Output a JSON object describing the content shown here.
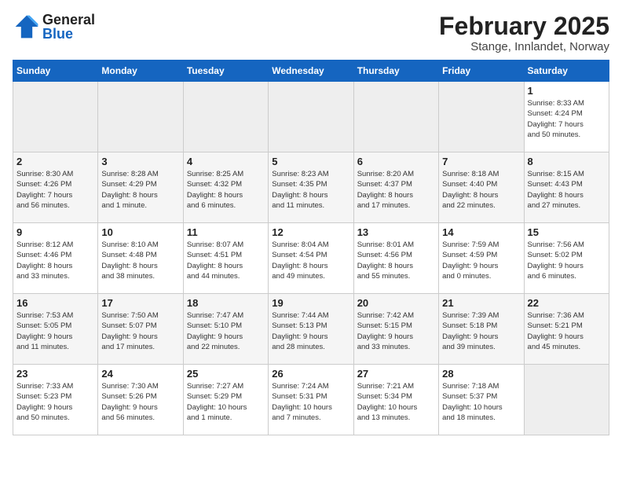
{
  "header": {
    "logo_general": "General",
    "logo_blue": "Blue",
    "title": "February 2025",
    "subtitle": "Stange, Innlandet, Norway"
  },
  "weekdays": [
    "Sunday",
    "Monday",
    "Tuesday",
    "Wednesday",
    "Thursday",
    "Friday",
    "Saturday"
  ],
  "weeks": [
    [
      {
        "num": "",
        "info": ""
      },
      {
        "num": "",
        "info": ""
      },
      {
        "num": "",
        "info": ""
      },
      {
        "num": "",
        "info": ""
      },
      {
        "num": "",
        "info": ""
      },
      {
        "num": "",
        "info": ""
      },
      {
        "num": "1",
        "info": "Sunrise: 8:33 AM\nSunset: 4:24 PM\nDaylight: 7 hours\nand 50 minutes."
      }
    ],
    [
      {
        "num": "2",
        "info": "Sunrise: 8:30 AM\nSunset: 4:26 PM\nDaylight: 7 hours\nand 56 minutes."
      },
      {
        "num": "3",
        "info": "Sunrise: 8:28 AM\nSunset: 4:29 PM\nDaylight: 8 hours\nand 1 minute."
      },
      {
        "num": "4",
        "info": "Sunrise: 8:25 AM\nSunset: 4:32 PM\nDaylight: 8 hours\nand 6 minutes."
      },
      {
        "num": "5",
        "info": "Sunrise: 8:23 AM\nSunset: 4:35 PM\nDaylight: 8 hours\nand 11 minutes."
      },
      {
        "num": "6",
        "info": "Sunrise: 8:20 AM\nSunset: 4:37 PM\nDaylight: 8 hours\nand 17 minutes."
      },
      {
        "num": "7",
        "info": "Sunrise: 8:18 AM\nSunset: 4:40 PM\nDaylight: 8 hours\nand 22 minutes."
      },
      {
        "num": "8",
        "info": "Sunrise: 8:15 AM\nSunset: 4:43 PM\nDaylight: 8 hours\nand 27 minutes."
      }
    ],
    [
      {
        "num": "9",
        "info": "Sunrise: 8:12 AM\nSunset: 4:46 PM\nDaylight: 8 hours\nand 33 minutes."
      },
      {
        "num": "10",
        "info": "Sunrise: 8:10 AM\nSunset: 4:48 PM\nDaylight: 8 hours\nand 38 minutes."
      },
      {
        "num": "11",
        "info": "Sunrise: 8:07 AM\nSunset: 4:51 PM\nDaylight: 8 hours\nand 44 minutes."
      },
      {
        "num": "12",
        "info": "Sunrise: 8:04 AM\nSunset: 4:54 PM\nDaylight: 8 hours\nand 49 minutes."
      },
      {
        "num": "13",
        "info": "Sunrise: 8:01 AM\nSunset: 4:56 PM\nDaylight: 8 hours\nand 55 minutes."
      },
      {
        "num": "14",
        "info": "Sunrise: 7:59 AM\nSunset: 4:59 PM\nDaylight: 9 hours\nand 0 minutes."
      },
      {
        "num": "15",
        "info": "Sunrise: 7:56 AM\nSunset: 5:02 PM\nDaylight: 9 hours\nand 6 minutes."
      }
    ],
    [
      {
        "num": "16",
        "info": "Sunrise: 7:53 AM\nSunset: 5:05 PM\nDaylight: 9 hours\nand 11 minutes."
      },
      {
        "num": "17",
        "info": "Sunrise: 7:50 AM\nSunset: 5:07 PM\nDaylight: 9 hours\nand 17 minutes."
      },
      {
        "num": "18",
        "info": "Sunrise: 7:47 AM\nSunset: 5:10 PM\nDaylight: 9 hours\nand 22 minutes."
      },
      {
        "num": "19",
        "info": "Sunrise: 7:44 AM\nSunset: 5:13 PM\nDaylight: 9 hours\nand 28 minutes."
      },
      {
        "num": "20",
        "info": "Sunrise: 7:42 AM\nSunset: 5:15 PM\nDaylight: 9 hours\nand 33 minutes."
      },
      {
        "num": "21",
        "info": "Sunrise: 7:39 AM\nSunset: 5:18 PM\nDaylight: 9 hours\nand 39 minutes."
      },
      {
        "num": "22",
        "info": "Sunrise: 7:36 AM\nSunset: 5:21 PM\nDaylight: 9 hours\nand 45 minutes."
      }
    ],
    [
      {
        "num": "23",
        "info": "Sunrise: 7:33 AM\nSunset: 5:23 PM\nDaylight: 9 hours\nand 50 minutes."
      },
      {
        "num": "24",
        "info": "Sunrise: 7:30 AM\nSunset: 5:26 PM\nDaylight: 9 hours\nand 56 minutes."
      },
      {
        "num": "25",
        "info": "Sunrise: 7:27 AM\nSunset: 5:29 PM\nDaylight: 10 hours\nand 1 minute."
      },
      {
        "num": "26",
        "info": "Sunrise: 7:24 AM\nSunset: 5:31 PM\nDaylight: 10 hours\nand 7 minutes."
      },
      {
        "num": "27",
        "info": "Sunrise: 7:21 AM\nSunset: 5:34 PM\nDaylight: 10 hours\nand 13 minutes."
      },
      {
        "num": "28",
        "info": "Sunrise: 7:18 AM\nSunset: 5:37 PM\nDaylight: 10 hours\nand 18 minutes."
      },
      {
        "num": "",
        "info": ""
      }
    ]
  ]
}
